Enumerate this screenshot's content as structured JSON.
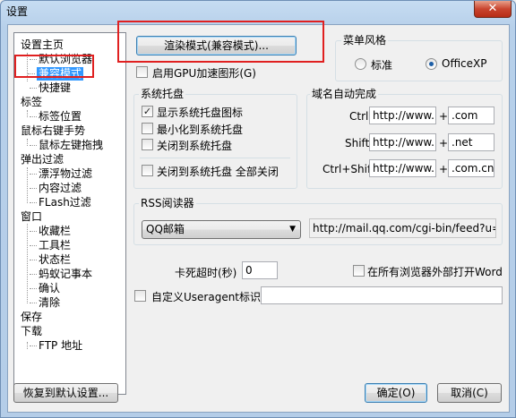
{
  "window": {
    "title": "设置",
    "close_label": "✕"
  },
  "tree": {
    "items": [
      {
        "label": "设置主页"
      },
      {
        "label": "默认浏览器"
      },
      {
        "label": "兼容模式"
      },
      {
        "label": "快捷键"
      },
      {
        "label": "标签"
      },
      {
        "label": "标签位置"
      },
      {
        "label": "鼠标右键手势"
      },
      {
        "label": "鼠标左键拖拽"
      },
      {
        "label": "弹出过滤"
      },
      {
        "label": "漂浮物过滤"
      },
      {
        "label": "内容过滤"
      },
      {
        "label": "FLash过滤"
      },
      {
        "label": "窗口"
      },
      {
        "label": "收藏栏"
      },
      {
        "label": "工具栏"
      },
      {
        "label": "状态栏"
      },
      {
        "label": "蚂蚁记事本"
      },
      {
        "label": "确认"
      },
      {
        "label": "清除"
      },
      {
        "label": "保存"
      },
      {
        "label": "下载"
      },
      {
        "label": "FTP 地址"
      }
    ]
  },
  "render_mode_button": "渲染模式(兼容模式)...",
  "gpu": {
    "label": "启用GPU加速图形(G)",
    "checked": false
  },
  "menu_style": {
    "title": "菜单风格",
    "options": [
      "标准",
      "OfficeXP"
    ],
    "selected": "OfficeXP"
  },
  "tray": {
    "title": "系统托盘",
    "options": [
      {
        "label": "显示系统托盘图标",
        "checked": true
      },
      {
        "label": "最小化到系统托盘",
        "checked": false
      },
      {
        "label": "关闭到系统托盘",
        "checked": false
      },
      {
        "label": "关闭到系统托盘 全部关闭",
        "checked": false
      }
    ]
  },
  "autocomplete": {
    "title": "域名自动完成",
    "rows": [
      {
        "key": "Ctrl",
        "prefix": "http://www.",
        "plus": "+",
        "suffix": ".com"
      },
      {
        "key": "Shift",
        "prefix": "http://www.",
        "plus": "+",
        "suffix": ".net"
      },
      {
        "key": "Ctrl+Shift",
        "prefix": "http://www.",
        "plus": "+",
        "suffix": ".com.cn"
      }
    ]
  },
  "rss": {
    "title": "RSS阅读器",
    "selected": "QQ邮箱",
    "url": "http://mail.qq.com/cgi-bin/feed?u="
  },
  "timeout": {
    "label": "卡死超时(秒)",
    "value": "0"
  },
  "word": {
    "label": "在所有浏览器外部打开Word",
    "checked": false
  },
  "useragent": {
    "label": "自定义Useragent标识:",
    "checked": false,
    "value": ""
  },
  "buttons": {
    "restore": "恢复到默认设置...",
    "ok": "确定(O)",
    "cancel": "取消(C)"
  },
  "colors": {
    "highlight_box": "#e02020",
    "selection": "#3399ff"
  }
}
